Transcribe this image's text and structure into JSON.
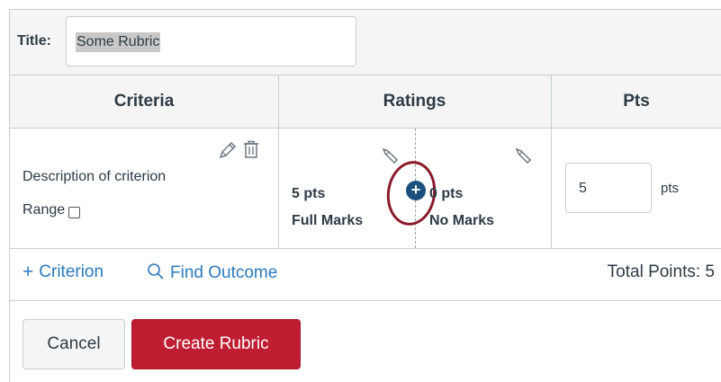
{
  "title_field": {
    "label": "Title:",
    "value": "Some Rubric"
  },
  "table": {
    "headers": {
      "criteria": "Criteria",
      "ratings": "Ratings",
      "pts": "Pts"
    },
    "criterion": {
      "description": "Description of criterion",
      "range_label": "Range",
      "range_checked": false,
      "ratings": [
        {
          "points": "5 pts",
          "label": "Full Marks"
        },
        {
          "points": "0 pts",
          "label": "No Marks"
        }
      ],
      "points_value": "5",
      "points_unit": "pts"
    }
  },
  "footer": {
    "add_criterion": "Criterion",
    "find_outcome": "Find Outcome",
    "total_points": "Total Points: 5"
  },
  "buttons": {
    "cancel": "Cancel",
    "create": "Create Rubric"
  },
  "icons": {
    "edit": "pencil-icon",
    "delete": "trash-icon",
    "add_rating": "plus-circle-icon",
    "add": "plus-icon",
    "search": "search-icon"
  },
  "colors": {
    "primary_button": "#bf1e32",
    "link": "#2b7abc",
    "add_rating_button": "#1b4f7c",
    "annotation_circle": "#8b1a2b"
  }
}
